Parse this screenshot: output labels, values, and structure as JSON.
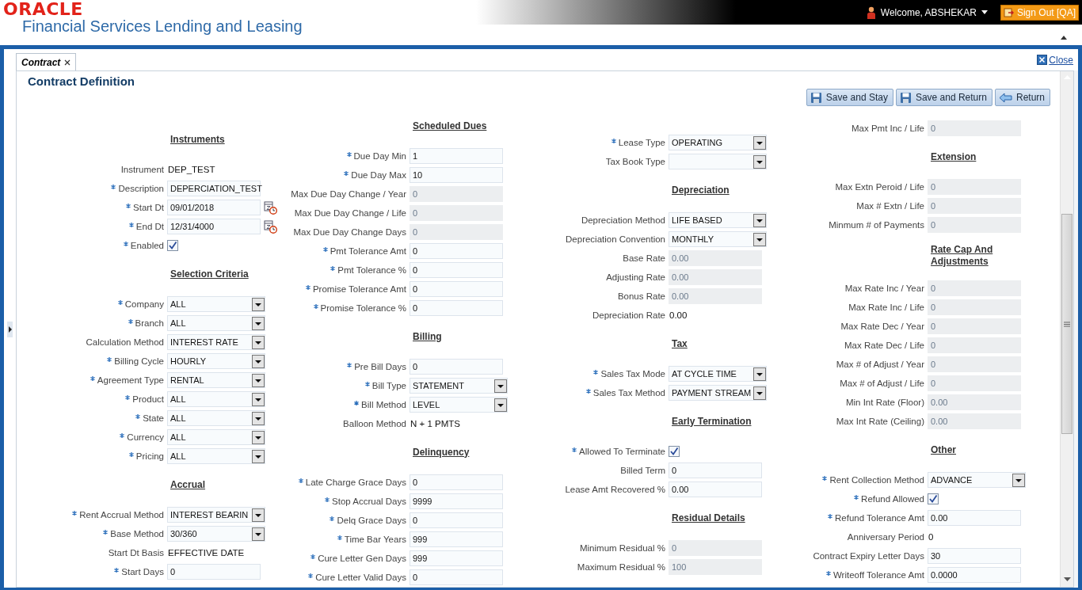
{
  "header": {
    "logo": "ORACLE",
    "product": "Financial Services Lending and Leasing",
    "user": "Welcome, ABSHEKAR",
    "sign_out": "Sign Out [QA]"
  },
  "tabs": [
    {
      "label": "Contract",
      "selected": true
    }
  ],
  "close_link": "Close",
  "page_title": "Contract Definition",
  "buttons": [
    {
      "kind": "save-stay",
      "label": "Save and Stay"
    },
    {
      "kind": "save-return",
      "label": "Save and Return"
    },
    {
      "kind": "return",
      "label": "Return"
    }
  ],
  "columns": [
    {
      "items": [
        {
          "kind": "heading",
          "label": "Instruments"
        },
        {
          "kind": "text",
          "label": "Instrument",
          "required": false,
          "value": "DEP_TEST"
        },
        {
          "kind": "input",
          "label": "Description",
          "required": true,
          "value": "DEPERCIATION_TEST",
          "disabled": false
        },
        {
          "kind": "date",
          "label": "Start Dt",
          "required": true,
          "value": "09/01/2018"
        },
        {
          "kind": "date",
          "label": "End Dt",
          "required": true,
          "value": "12/31/4000"
        },
        {
          "kind": "checkbox",
          "label": "Enabled",
          "required": true,
          "checked": true
        },
        {
          "kind": "heading",
          "label": "Selection Criteria"
        },
        {
          "kind": "select",
          "label": "Company",
          "required": true,
          "value": "ALL"
        },
        {
          "kind": "select",
          "label": "Branch",
          "required": true,
          "value": "ALL"
        },
        {
          "kind": "select",
          "label": "Calculation Method",
          "required": false,
          "value": "INTEREST RATE"
        },
        {
          "kind": "select",
          "label": "Billing Cycle",
          "required": true,
          "value": "HOURLY"
        },
        {
          "kind": "select",
          "label": "Agreement Type",
          "required": true,
          "value": "RENTAL"
        },
        {
          "kind": "select",
          "label": "Product",
          "required": true,
          "value": "ALL"
        },
        {
          "kind": "select",
          "label": "State",
          "required": true,
          "value": "ALL"
        },
        {
          "kind": "select",
          "label": "Currency",
          "required": true,
          "value": "ALL"
        },
        {
          "kind": "select",
          "label": "Pricing",
          "required": true,
          "value": "ALL"
        },
        {
          "kind": "heading",
          "label": "Accrual"
        },
        {
          "kind": "select",
          "label": "Rent Accrual Method",
          "required": true,
          "value": "INTEREST BEARIN"
        },
        {
          "kind": "select",
          "label": "Base Method",
          "required": true,
          "value": "30/360"
        },
        {
          "kind": "text",
          "label": "Start Dt Basis",
          "required": false,
          "value": "EFFECTIVE DATE"
        },
        {
          "kind": "input",
          "label": "Start Days",
          "required": true,
          "value": "0",
          "disabled": false
        }
      ]
    },
    {
      "items": [
        {
          "kind": "heading",
          "label": "Scheduled Dues"
        },
        {
          "kind": "input",
          "label": "Due Day Min",
          "required": true,
          "value": "1",
          "disabled": false
        },
        {
          "kind": "input",
          "label": "Due Day Max",
          "required": true,
          "value": "10",
          "disabled": false
        },
        {
          "kind": "input",
          "label": "Max Due Day Change / Year",
          "required": false,
          "value": "0",
          "disabled": true
        },
        {
          "kind": "input",
          "label": "Max Due Day Change / Life",
          "required": false,
          "value": "0",
          "disabled": true
        },
        {
          "kind": "input",
          "label": "Max Due Day Change Days",
          "required": false,
          "value": "0",
          "disabled": true
        },
        {
          "kind": "input",
          "label": "Pmt Tolerance Amt",
          "required": true,
          "value": "0",
          "disabled": false
        },
        {
          "kind": "input",
          "label": "Pmt Tolerance %",
          "required": true,
          "value": "0",
          "disabled": false
        },
        {
          "kind": "input",
          "label": "Promise Tolerance Amt",
          "required": true,
          "value": "0",
          "disabled": false
        },
        {
          "kind": "input",
          "label": "Promise Tolerance %",
          "required": true,
          "value": "0",
          "disabled": false
        },
        {
          "kind": "heading",
          "label": "Billing"
        },
        {
          "kind": "input",
          "label": "Pre Bill Days",
          "required": true,
          "value": "0",
          "disabled": false
        },
        {
          "kind": "select",
          "label": "Bill Type",
          "required": true,
          "value": "STATEMENT"
        },
        {
          "kind": "select",
          "label": "Bill Method",
          "required": true,
          "value": "LEVEL"
        },
        {
          "kind": "text",
          "label": "Balloon Method",
          "required": false,
          "value": "N + 1 PMTS"
        },
        {
          "kind": "heading",
          "label": "Delinquency"
        },
        {
          "kind": "input",
          "label": "Late Charge Grace Days",
          "required": true,
          "value": "0",
          "disabled": false
        },
        {
          "kind": "input",
          "label": "Stop Accrual Days",
          "required": true,
          "value": "9999",
          "disabled": false
        },
        {
          "kind": "input",
          "label": "Delq Grace Days",
          "required": true,
          "value": "0",
          "disabled": false
        },
        {
          "kind": "input",
          "label": "Time Bar Years",
          "required": true,
          "value": "999",
          "disabled": false
        },
        {
          "kind": "input",
          "label": "Cure Letter Gen Days",
          "required": true,
          "value": "999",
          "disabled": false
        },
        {
          "kind": "input",
          "label": "Cure Letter Valid Days",
          "required": true,
          "value": "0",
          "disabled": false
        }
      ]
    },
    {
      "items": [
        {
          "kind": "select",
          "label": "Lease Type",
          "required": true,
          "value": "OPERATING"
        },
        {
          "kind": "select",
          "label": "Tax Book Type",
          "required": false
        },
        {
          "kind": "heading",
          "label": "Depreciation"
        },
        {
          "kind": "select",
          "label": "Depreciation Method",
          "required": false,
          "value": "LIFE BASED"
        },
        {
          "kind": "select",
          "label": "Depreciation Convention",
          "required": false,
          "value": "MONTHLY"
        },
        {
          "kind": "input",
          "label": "Base Rate",
          "required": false,
          "value": "0.00",
          "disabled": true
        },
        {
          "kind": "input",
          "label": "Adjusting Rate",
          "required": false,
          "value": "0.00",
          "disabled": true
        },
        {
          "kind": "input",
          "label": "Bonus Rate",
          "required": false,
          "value": "0.00",
          "disabled": true
        },
        {
          "kind": "text",
          "label": "Depreciation Rate",
          "required": false,
          "value": "0.00"
        },
        {
          "kind": "heading",
          "label": "Tax"
        },
        {
          "kind": "select",
          "label": "Sales Tax Mode",
          "required": true,
          "value": "AT CYCLE TIME"
        },
        {
          "kind": "select",
          "label": "Sales Tax Method",
          "required": true,
          "value": "PAYMENT STREAM"
        },
        {
          "kind": "heading",
          "label": "Early Termination"
        },
        {
          "kind": "checkbox",
          "label": "Allowed To Terminate",
          "required": true,
          "checked": true
        },
        {
          "kind": "input",
          "label": "Billed Term",
          "required": false,
          "value": "0",
          "disabled": false
        },
        {
          "kind": "input",
          "label": "Lease Amt Recovered %",
          "required": false,
          "value": "0.00",
          "disabled": false
        },
        {
          "kind": "heading",
          "label": "Residual Details"
        },
        {
          "kind": "input",
          "label": "Minimum Residual %",
          "required": false,
          "value": "0",
          "disabled": true
        },
        {
          "kind": "input",
          "label": "Maximum Residual %",
          "required": false,
          "value": "100",
          "disabled": true
        }
      ]
    },
    {
      "items": [
        {
          "kind": "input",
          "label": "Max Pmt Inc / Life",
          "required": false,
          "value": "0",
          "disabled": true
        },
        {
          "kind": "heading",
          "label": "Extension"
        },
        {
          "kind": "input",
          "label": "Max Extn Peroid / Life",
          "required": false,
          "value": "0",
          "disabled": true
        },
        {
          "kind": "input",
          "label": "Max # Extn / Life",
          "required": false,
          "value": "0",
          "disabled": true
        },
        {
          "kind": "input",
          "label": "Minmum # of Payments",
          "required": false,
          "value": "0",
          "disabled": true
        },
        {
          "kind": "heading",
          "label": "Rate Cap And Adjustments"
        },
        {
          "kind": "input",
          "label": "Max Rate Inc / Year",
          "required": false,
          "value": "0",
          "disabled": true
        },
        {
          "kind": "input",
          "label": "Max Rate Inc / Life",
          "required": false,
          "value": "0",
          "disabled": true
        },
        {
          "kind": "input",
          "label": "Max Rate Dec / Year",
          "required": false,
          "value": "0",
          "disabled": true
        },
        {
          "kind": "input",
          "label": "Max Rate Dec / Life",
          "required": false,
          "value": "0",
          "disabled": true
        },
        {
          "kind": "input",
          "label": "Max # of Adjust / Year",
          "required": false,
          "value": "0",
          "disabled": true
        },
        {
          "kind": "input",
          "label": "Max # of Adjust / Life",
          "required": false,
          "value": "0",
          "disabled": true
        },
        {
          "kind": "input",
          "label": "Min Int Rate (Floor)",
          "required": false,
          "value": "0.00",
          "disabled": true
        },
        {
          "kind": "input",
          "label": "Max Int Rate (Ceiling)",
          "required": false,
          "value": "0.00",
          "disabled": true
        },
        {
          "kind": "heading",
          "label": "Other"
        },
        {
          "kind": "select",
          "label": "Rent Collection Method",
          "required": true,
          "value": "ADVANCE"
        },
        {
          "kind": "checkbox",
          "label": "Refund Allowed",
          "required": true,
          "checked": true
        },
        {
          "kind": "input",
          "label": "Refund Tolerance Amt",
          "required": true,
          "value": "0.00",
          "disabled": false
        },
        {
          "kind": "text",
          "label": "Anniversary Period",
          "required": false,
          "value": "0"
        },
        {
          "kind": "input",
          "label": "Contract Expiry Letter Days",
          "required": false,
          "value": "30",
          "disabled": false
        },
        {
          "kind": "input",
          "label": "Writeoff Tolerance Amt",
          "required": true,
          "value": "0.0000",
          "disabled": false
        }
      ]
    }
  ]
}
